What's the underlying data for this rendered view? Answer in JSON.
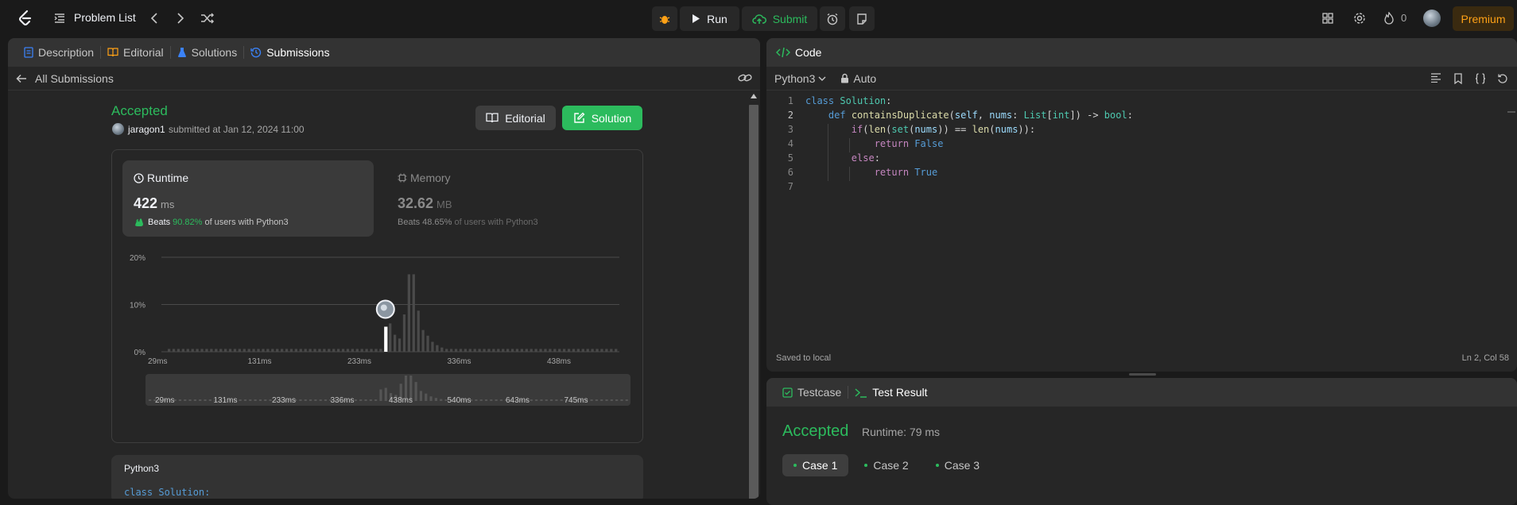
{
  "topbar": {
    "problem_list": "Problem List",
    "run": "Run",
    "submit": "Submit",
    "streak": "0",
    "premium": "Premium"
  },
  "left_tabs": [
    {
      "label": "Description",
      "icon": "description-icon"
    },
    {
      "label": "Editorial",
      "icon": "book-icon"
    },
    {
      "label": "Solutions",
      "icon": "flask-icon"
    },
    {
      "label": "Submissions",
      "icon": "history-icon"
    }
  ],
  "back_label": "All Submissions",
  "submission": {
    "status": "Accepted",
    "user": "jaragon1",
    "submitted_at": "submitted at Jan 12, 2024 11:00",
    "editorial_btn": "Editorial",
    "solution_btn": "Solution"
  },
  "runtime": {
    "label": "Runtime",
    "value": "422",
    "unit": "ms",
    "beats_prefix": "Beats",
    "beats_pct": "90.82%",
    "beats_suffix": "of users with Python3"
  },
  "memory": {
    "label": "Memory",
    "value": "32.62",
    "unit": "MB",
    "beats_prefix": "Beats",
    "beats_pct": "48.65%",
    "beats_suffix": "of users with Python3"
  },
  "chart_data": {
    "type": "bar",
    "y_ticks": [
      "20%",
      "10%",
      "0%"
    ],
    "ylim": [
      0,
      20
    ],
    "x_tick_labels": [
      "29ms",
      "131ms",
      "233ms",
      "336ms",
      "438ms",
      "540ms",
      "643ms",
      "745ms"
    ],
    "values": [
      0.6,
      0.6,
      0.6,
      0.6,
      0.6,
      0.6,
      0.6,
      0.6,
      0.6,
      0.6,
      0.6,
      0.6,
      0.6,
      0.6,
      0.6,
      0.6,
      0.6,
      0.6,
      0.6,
      0.6,
      0.6,
      0.6,
      0.6,
      0.6,
      0.6,
      0.6,
      0.6,
      0.6,
      0.6,
      0.6,
      0.6,
      0.6,
      0.6,
      0.6,
      0.6,
      0.6,
      0.6,
      0.6,
      0.6,
      0.6,
      0.6,
      0.6,
      0.6,
      0.6,
      0.6,
      0.6,
      5.3,
      6.0,
      3.6,
      2.8,
      7.9,
      16.4,
      16.4,
      8.7,
      4.6,
      3.4,
      2.1,
      1.4,
      0.9,
      0.6,
      0.6,
      0.6,
      0.6,
      0.6,
      0.6,
      0.6,
      0.6,
      0.6,
      0.6,
      0.6,
      0.6,
      0.6,
      0.6,
      0.6,
      0.6,
      0.6,
      0.6,
      0.6,
      0.6,
      0.6,
      0.6,
      0.6,
      0.6,
      0.6,
      0.6,
      0.6,
      0.6,
      0.6,
      0.6,
      0.6,
      0.6,
      0.6,
      0.6,
      0.6,
      0.6,
      0.6
    ],
    "highlight_index": 46,
    "grid": true
  },
  "code_preview": {
    "lang": "Python3",
    "first_line": "class Solution:"
  },
  "editor": {
    "title": "Code",
    "lang": "Python3",
    "mode": "Auto",
    "line_numbers": [
      "1",
      "2",
      "3",
      "4",
      "5",
      "6",
      "7"
    ],
    "saved": "Saved to local",
    "cursor": "Ln 2, Col 58"
  },
  "test": {
    "tab_testcase": "Testcase",
    "tab_result": "Test Result",
    "status": "Accepted",
    "runtime": "Runtime: 79 ms",
    "cases": [
      "Case 1",
      "Case 2",
      "Case 3"
    ]
  }
}
